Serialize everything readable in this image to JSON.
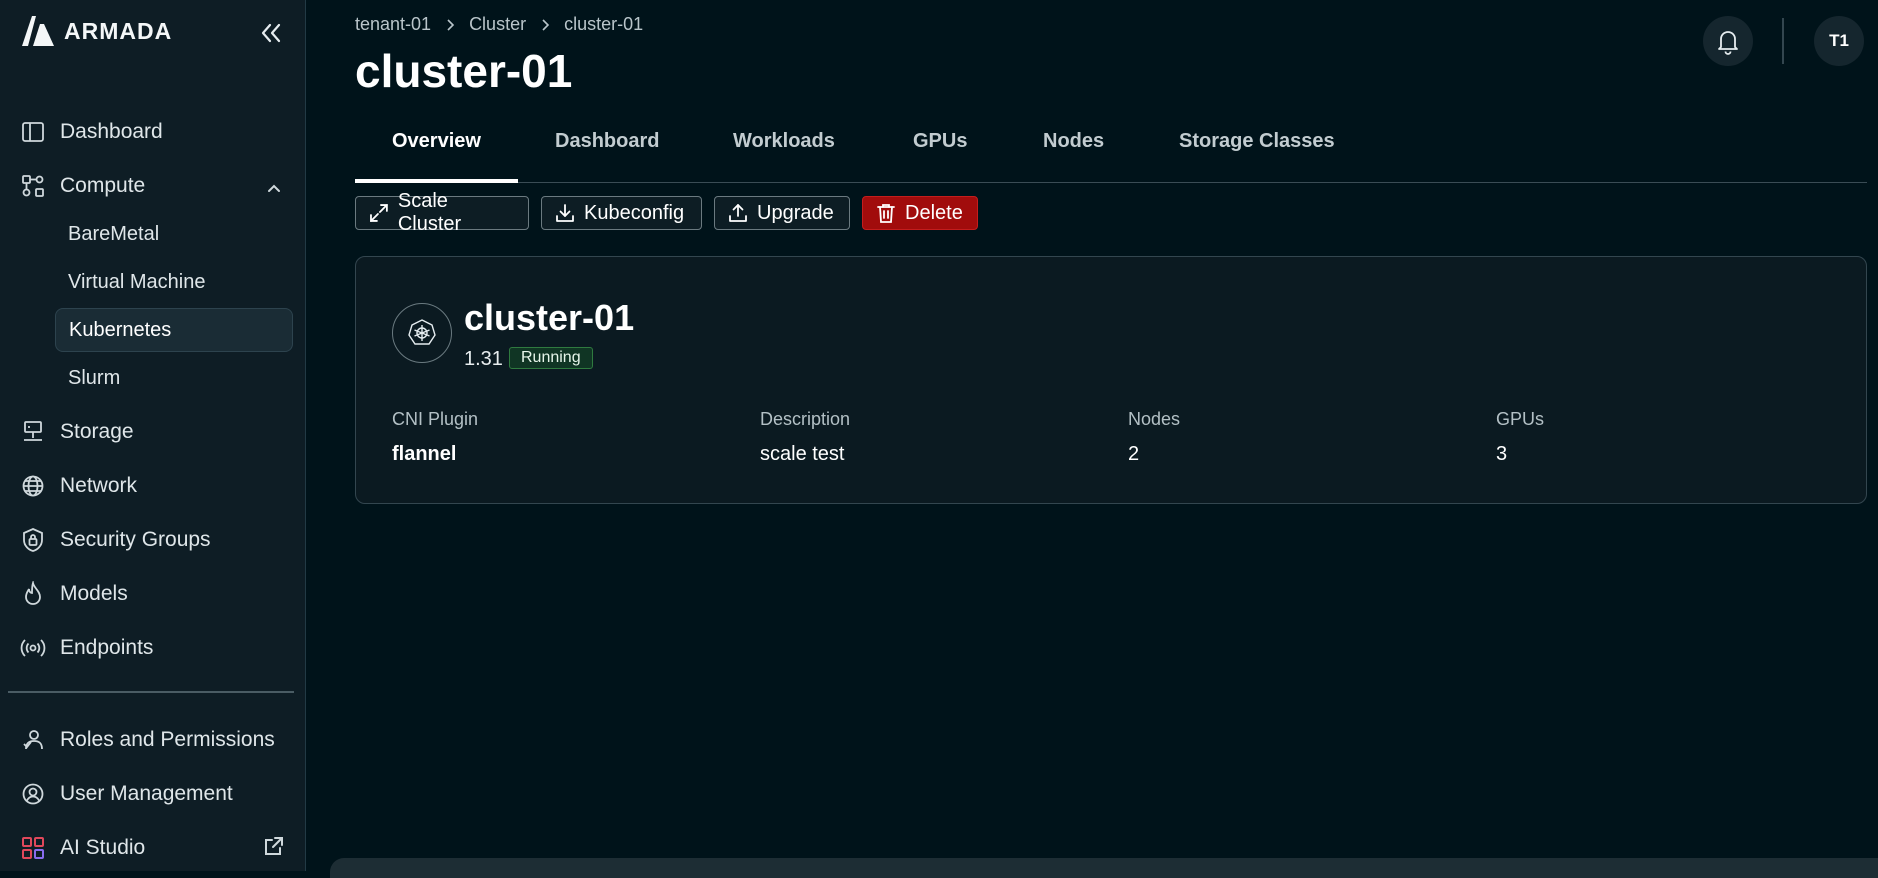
{
  "app": {
    "name": "ARMADA"
  },
  "sidebar": {
    "items": [
      {
        "label": "Dashboard",
        "icon": "panel-icon"
      },
      {
        "label": "Compute",
        "icon": "workflow-icon"
      },
      {
        "label": "Storage",
        "icon": "server-icon"
      },
      {
        "label": "Network",
        "icon": "globe-icon"
      },
      {
        "label": "Security Groups",
        "icon": "shield-icon"
      },
      {
        "label": "Models",
        "icon": "flame-icon"
      },
      {
        "label": "Endpoints",
        "icon": "broadcast-icon"
      },
      {
        "label": "Roles and Permissions",
        "icon": "users-icon"
      },
      {
        "label": "User Management",
        "icon": "user-circle-icon"
      },
      {
        "label": "AI Studio",
        "icon": "grid-icon"
      }
    ],
    "compute_sub": [
      "BareMetal",
      "Virtual Machine",
      "Kubernetes",
      "Slurm"
    ],
    "active_sub": "Kubernetes"
  },
  "breadcrumb": [
    "tenant-01",
    "Cluster",
    "cluster-01"
  ],
  "page": {
    "title": "cluster-01"
  },
  "header": {
    "avatar": "T1"
  },
  "tabs": [
    "Overview",
    "Dashboard",
    "Workloads",
    "GPUs",
    "Nodes",
    "Storage Classes"
  ],
  "actions": {
    "scale": "Scale Cluster",
    "kubeconfig": "Kubeconfig",
    "upgrade": "Upgrade",
    "delete": "Delete"
  },
  "card": {
    "title": "cluster-01",
    "version": "1.31",
    "status": "Running",
    "fields": [
      {
        "label": "CNI Plugin",
        "value": "flannel"
      },
      {
        "label": "Description",
        "value": "scale test"
      },
      {
        "label": "Nodes",
        "value": "2"
      },
      {
        "label": "GPUs",
        "value": "3"
      }
    ]
  },
  "colors": {
    "background": "#00131a",
    "sidebar": "#0e1d25",
    "danger": "#a10c0c",
    "status_running": "#103524"
  }
}
